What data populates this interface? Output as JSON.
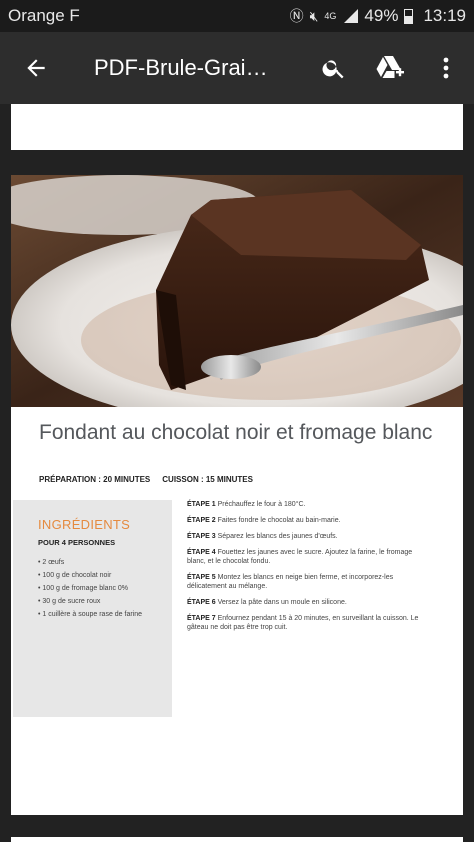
{
  "status": {
    "carrier": "Orange F",
    "network": "4G",
    "battery": "49%",
    "time": "13:19"
  },
  "appbar": {
    "title": "PDF-Brule-Grai…"
  },
  "icons": {
    "back": "arrow-left-icon",
    "search": "search-icon",
    "drive": "google-drive-add-icon",
    "more": "more-vert-icon"
  },
  "recipe": {
    "title": "Fondant au chocolat noir et fromage blanc",
    "preparation": "PRÉPARATION : 20 MINUTES",
    "cuisson": "CUISSON : 15 MINUTES",
    "ingredients_title": "INGRÉDIENTS",
    "servings": "POUR 4 PERSONNES",
    "ingredients": [
      "2 œufs",
      "100 g de chocolat noir",
      "100 g de fromage blanc 0%",
      "30 g de sucre roux",
      "1 cuillère à soupe rase de farine"
    ],
    "steps": [
      {
        "label": "ÉTAPE 1",
        "text": "Préchauffez le four à 180°C."
      },
      {
        "label": "ÉTAPE 2",
        "text": "Faites fondre le chocolat au bain-marie."
      },
      {
        "label": "ÉTAPE 3",
        "text": "Séparez les blancs des jaunes d'œufs."
      },
      {
        "label": "ÉTAPE 4",
        "text": "Fouettez les jaunes avec le sucre. Ajoutez la farine, le fromage blanc, et le chocolat fondu."
      },
      {
        "label": "ÉTAPE 5",
        "text": "Montez les blancs en neige bien ferme, et incorporez-les délicatement au mélange."
      },
      {
        "label": "ÉTAPE 6",
        "text": "Versez la pâte dans un moule en silicone."
      },
      {
        "label": "ÉTAPE 7",
        "text": "Enfournez pendant 15 à 20 minutes, en surveillant la cuisson. Le gâteau ne doit pas être trop cuit."
      }
    ]
  }
}
